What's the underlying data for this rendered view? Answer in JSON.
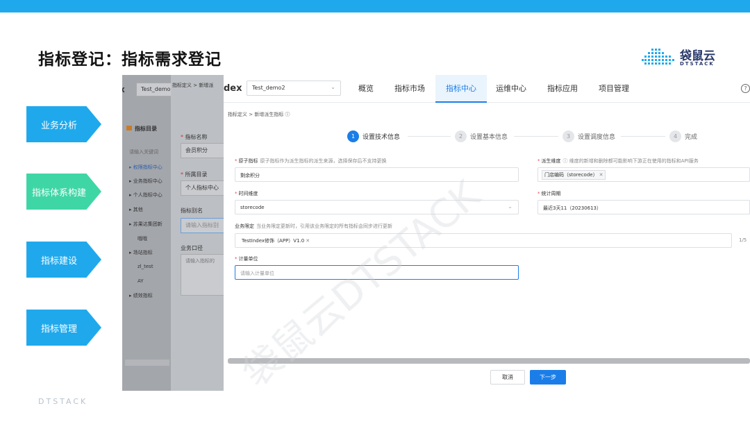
{
  "slide": {
    "title": "指标登记：指标需求登记",
    "brand_name": "袋鼠云",
    "brand_sub": "DTSTACK",
    "footer": "DTSTACK",
    "accent": "#1fa9ec",
    "green": "#3fd6a5"
  },
  "side_steps": [
    {
      "label": "业务分析"
    },
    {
      "label": "指标体系构建"
    },
    {
      "label": "指标建设"
    },
    {
      "label": "指标管理"
    }
  ],
  "bg_app": {
    "project": "Test_demo2",
    "crumb": "指标定义 > 新增派",
    "catalog_title": "指标目录",
    "search_placeholder": "请输入关键词",
    "tree": [
      "权限指标中心",
      "业务指标中心",
      "个人指标中心",
      "其他",
      "苏果达集团新",
      "哦哦",
      "场站指标",
      "zl_test",
      "AY",
      "绩效指标"
    ],
    "name_label": "指标名称",
    "name_value": "会员积分",
    "dir_label": "所属目录",
    "dir_value": "个人指标中心",
    "alias_label": "指标别名",
    "alias_placeholder": "请输入指标别",
    "caliber_label": "业务口径",
    "caliber_placeholder": "请输入指标的"
  },
  "app": {
    "logo_fragment": "dex",
    "project": "Test_demo2",
    "nav": [
      {
        "label": "概览",
        "active": false
      },
      {
        "label": "指标市场",
        "active": false
      },
      {
        "label": "指标中心",
        "active": true
      },
      {
        "label": "运维中心",
        "active": false
      },
      {
        "label": "指标应用",
        "active": false
      },
      {
        "label": "项目管理",
        "active": false
      }
    ],
    "breadcrumb": "指标定义 > 新增派生指标 ⓘ",
    "steps": [
      {
        "num": "1",
        "label": "设置技术信息",
        "active": true
      },
      {
        "num": "2",
        "label": "设置基本信息",
        "active": false
      },
      {
        "num": "3",
        "label": "设置调度信息",
        "active": false
      },
      {
        "num": "4",
        "label": "完成",
        "active": false
      }
    ],
    "form": {
      "atomic_label": "原子指标",
      "atomic_hint": "原子指标作为派生指标的派生来源，选择保存后不支持更换",
      "atomic_value": "剩余积分",
      "derive_dim_label": "派生维度",
      "derive_dim_hint": "ⓘ 维度的新增和删除都可能影响下游正在使用的指标和API服务",
      "derive_dim_tag": "门店编码（storecode）",
      "time_dim_label": "时间维度",
      "time_dim_value": "storecode",
      "period_label": "统计周期",
      "period_value": "最近3天11（20230613）",
      "limit_label": "业务限定",
      "limit_hint": "当业务限定更新时，引用该业务限定的所有指标会同步进行更新",
      "limit_tag": "TestIndex修饰（APP）V1.0",
      "limit_counter": "1/5",
      "unit_label": "计量单位",
      "unit_placeholder": "请输入计量单位"
    },
    "cancel_label": "取消",
    "next_label": "下一步"
  },
  "watermark": "袋鼠云DTSTACK"
}
